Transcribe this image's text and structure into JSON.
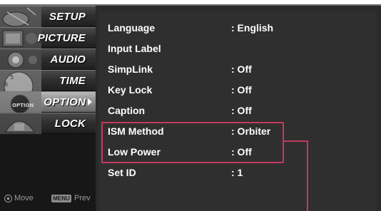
{
  "sidebar": {
    "items": [
      {
        "label": "SETUP",
        "icon": "satellite-dish-thumbnail"
      },
      {
        "label": "PICTURE",
        "icon": "filmstrip-thumbnail"
      },
      {
        "label": "AUDIO",
        "icon": "speaker-thumbnail"
      },
      {
        "label": "TIME",
        "icon": "clock-thumbnail"
      },
      {
        "label": "OPTION",
        "icon": "option-dial-thumbnail",
        "selected": true
      },
      {
        "label": "LOCK",
        "icon": "lock-thumbnail"
      }
    ],
    "hint": {
      "move_icon": "dpad-icon",
      "move_label": "Move",
      "menu_key": "MENU",
      "prev_label": "Prev"
    }
  },
  "option_menu": {
    "rows": [
      {
        "label": "Language",
        "value": ": English"
      },
      {
        "label": "Input Label",
        "value": ""
      },
      {
        "label": "SimpLink",
        "value": ": Off"
      },
      {
        "label": "Key Lock",
        "value": ": Off"
      },
      {
        "label": "Caption",
        "value": ": Off"
      },
      {
        "label": "ISM Method",
        "value": ": Orbiter"
      },
      {
        "label": "Low Power",
        "value": ": Off"
      },
      {
        "label": "Set ID",
        "value": ": 1"
      }
    ]
  },
  "colors": {
    "highlight": "#c4385e",
    "panel": "#2f2f2f",
    "sidebar": "#1c1c1c",
    "selected_item": "#8e8e8e"
  }
}
